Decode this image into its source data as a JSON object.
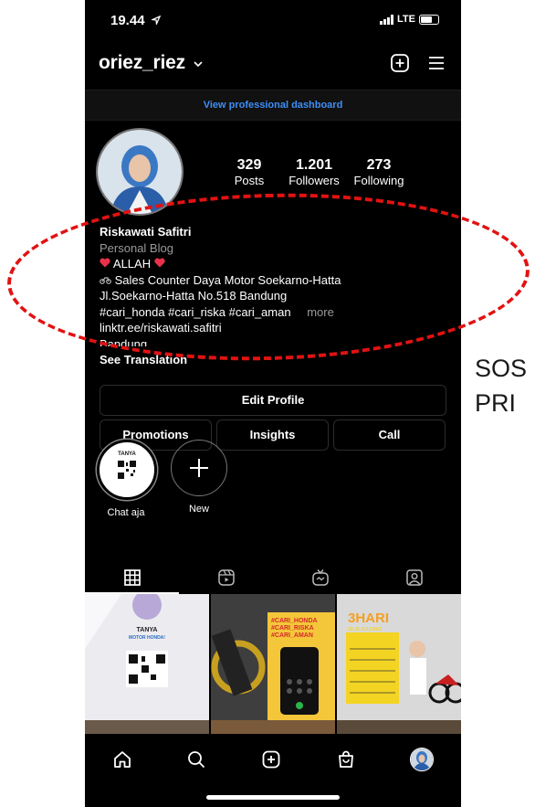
{
  "status_bar": {
    "time": "19.44",
    "network": "LTE"
  },
  "header": {
    "username": "oriez_riez"
  },
  "professional_dashboard": {
    "label": "View professional dashboard"
  },
  "stats": [
    {
      "value": "329",
      "label": "Posts"
    },
    {
      "value": "1.201",
      "label": "Followers"
    },
    {
      "value": "273",
      "label": "Following"
    }
  ],
  "bio": {
    "name": "Riskawati Safitri",
    "category": "Personal Blog",
    "line1": "ALLAH",
    "line2": "Sales Counter Daya Motor Soekarno-Hatta",
    "line3": "Jl.Soekarno-Hatta No.518 Bandung",
    "line4": "#cari_honda #cari_riska #cari_aman",
    "more": "more",
    "link": "linktr.ee/riskawati.safitri",
    "city": "Bandung",
    "see_translation": "See Translation"
  },
  "buttons": {
    "edit_profile": "Edit Profile",
    "promotions": "Promotions",
    "insights": "Insights",
    "call": "Call"
  },
  "highlights": [
    {
      "label": "Chat aja",
      "inner_text": "TANYA"
    },
    {
      "label": "New"
    }
  ],
  "grid_posts": [
    {
      "texts": [
        "TANYA",
        "MOTOR HONDA!"
      ]
    },
    {
      "texts": [
        "#CARI_HONDA",
        "#CARI_RISKA",
        "#CARI_AMAN"
      ]
    },
    {
      "texts": [
        "3HARI",
        "28-30 JULI 2021"
      ]
    }
  ],
  "annotation": {
    "text_line1": "SOS",
    "text_line2": "PRI"
  },
  "colors": {
    "background": "#000000",
    "link_blue": "#3e8ef7",
    "annotation_red": "#e21212",
    "muted": "#9a9a9a"
  }
}
